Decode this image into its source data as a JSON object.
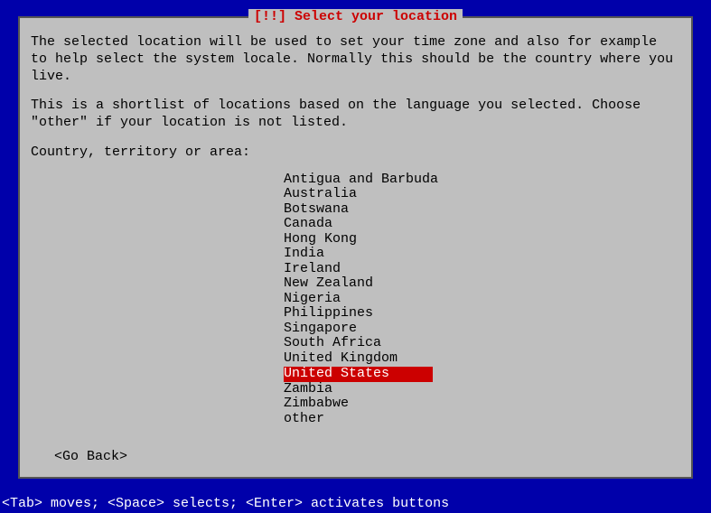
{
  "dialog": {
    "title": "[!!] Select your location",
    "description1": "The selected location will be used to set your time zone and also for example to help select the system locale. Normally this should be the country where you live.",
    "description2": "This is a shortlist of locations based on the language you selected. Choose \"other\" if your location is not listed.",
    "prompt": "Country, territory or area:",
    "items": [
      {
        "label": "Antigua and Barbuda",
        "selected": false
      },
      {
        "label": "Australia",
        "selected": false
      },
      {
        "label": "Botswana",
        "selected": false
      },
      {
        "label": "Canada",
        "selected": false
      },
      {
        "label": "Hong Kong",
        "selected": false
      },
      {
        "label": "India",
        "selected": false
      },
      {
        "label": "Ireland",
        "selected": false
      },
      {
        "label": "New Zealand",
        "selected": false
      },
      {
        "label": "Nigeria",
        "selected": false
      },
      {
        "label": "Philippines",
        "selected": false
      },
      {
        "label": "Singapore",
        "selected": false
      },
      {
        "label": "South Africa",
        "selected": false
      },
      {
        "label": "United Kingdom",
        "selected": false
      },
      {
        "label": "United States",
        "selected": true
      },
      {
        "label": "Zambia",
        "selected": false
      },
      {
        "label": "Zimbabwe",
        "selected": false
      },
      {
        "label": "other",
        "selected": false
      }
    ],
    "goBack": "<Go Back>"
  },
  "footer": "<Tab> moves; <Space> selects; <Enter> activates buttons"
}
